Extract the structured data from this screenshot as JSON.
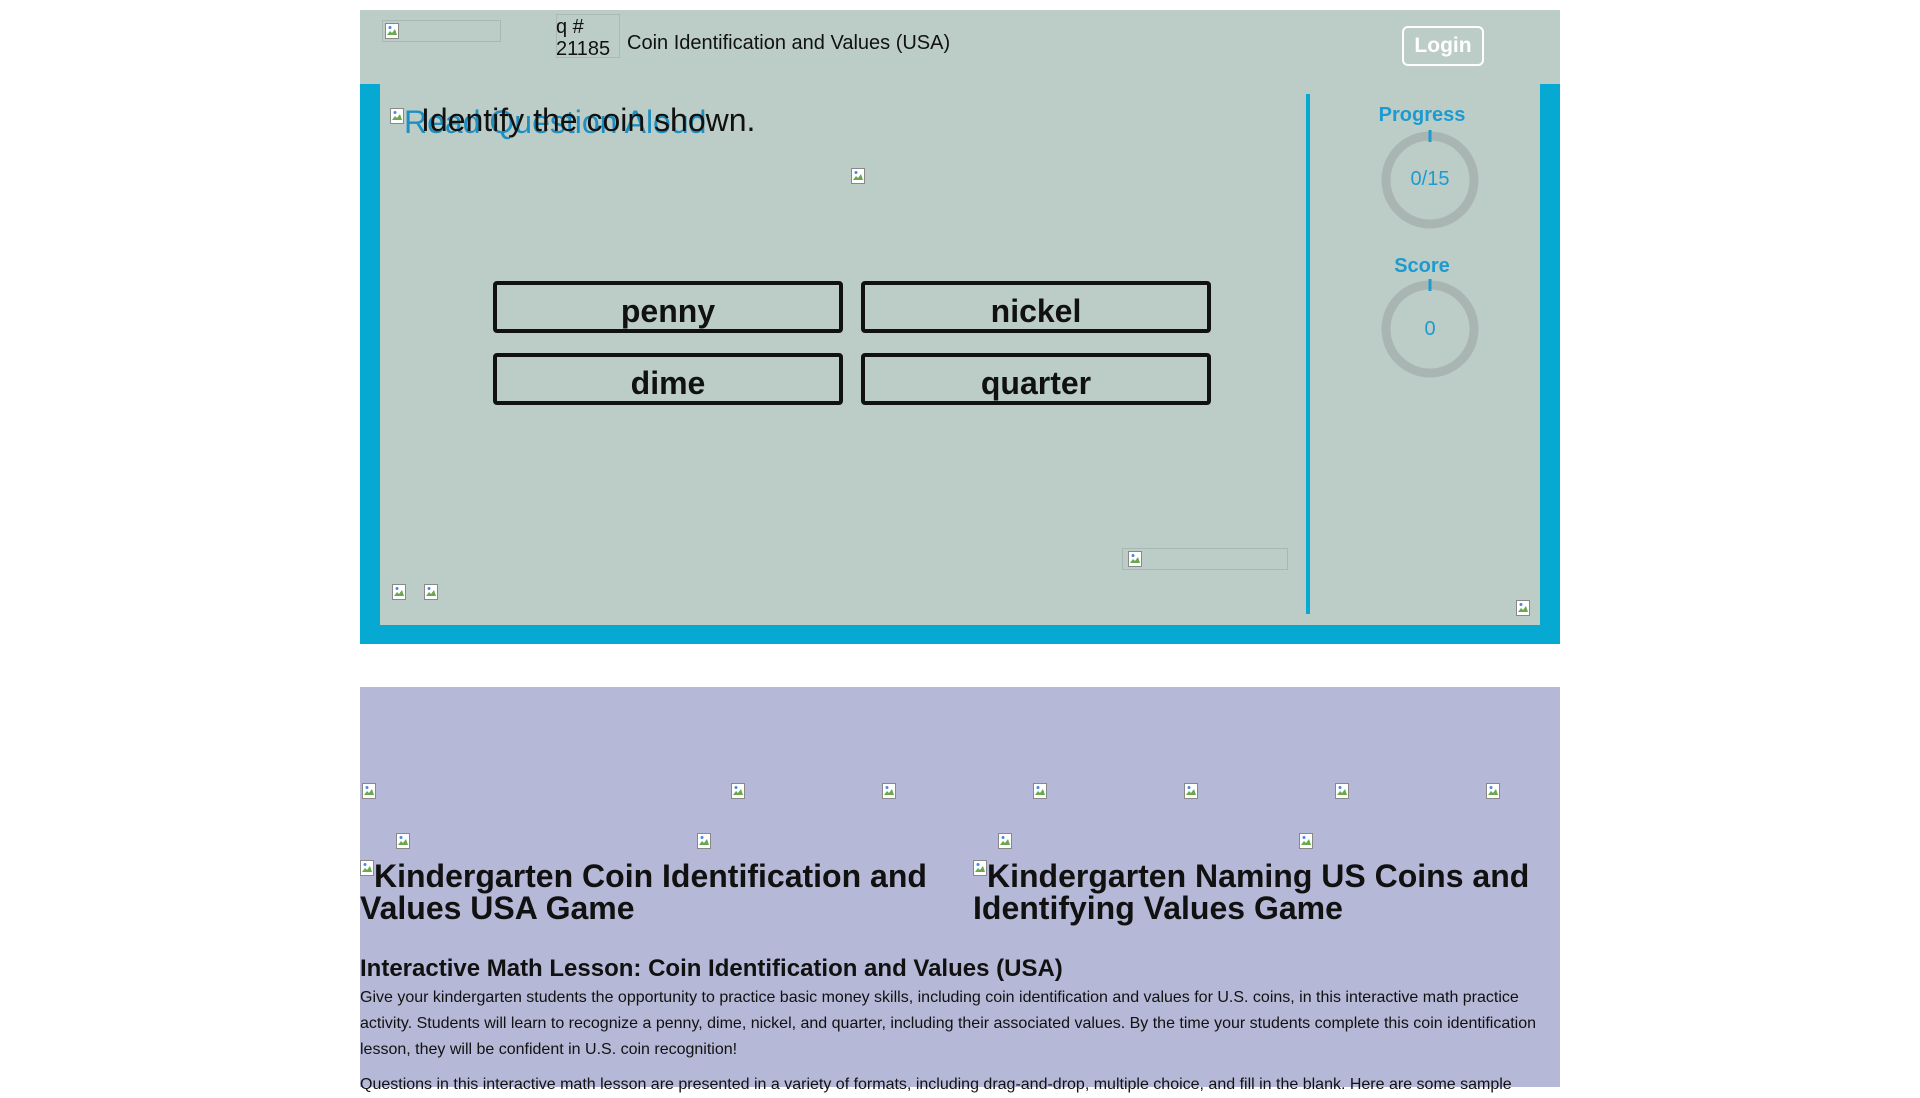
{
  "header": {
    "question_number": "q # 21185",
    "title": "Coin Identification and Values (USA)",
    "login_label": "Login"
  },
  "question": {
    "read_aloud_label": "Read Question Aloud",
    "prompt": "Identify the coin shown."
  },
  "answers": [
    "penny",
    "nickel",
    "dime",
    "quarter"
  ],
  "sidebar": {
    "progress_label": "Progress",
    "progress_value": "0/15",
    "progress_fraction": 0,
    "score_label": "Score",
    "score_value": "0"
  },
  "games": [
    {
      "title": "Kindergarten Coin Identification and Values USA Game"
    },
    {
      "title": "Kindergarten Naming US Coins and Identifying Values Game"
    }
  ],
  "lesson": {
    "heading": "Interactive Math Lesson: Coin Identification and Values (USA)",
    "paragraph": "Give your kindergarten students the opportunity to practice basic money skills, including coin identification and values for U.S. coins, in this interactive math practice activity. Students will learn to recognize a penny, dime, nickel, and quarter, including their associated values. By the time your students complete this coin identification lesson, they will be confident in U.S. coin recognition!",
    "paragraph2": "Questions in this interactive math lesson are presented in a variety of formats, including drag-and-drop, multiple choice, and fill in the blank. Here are some sample"
  },
  "colors": {
    "panel_bg": "#bccdc8",
    "frame_accent": "#05a9d2",
    "info_bg": "#b5b8d6",
    "stat_text": "#1d9bd0"
  }
}
